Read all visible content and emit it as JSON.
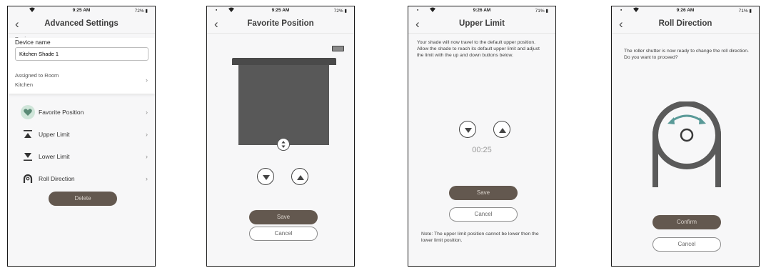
{
  "status": {
    "screen1_time": "9:25 AM",
    "screen1_battery": "72%",
    "screen2_time": "9:25 AM",
    "screen2_battery": "72%",
    "screen3_time": "9:26 AM",
    "screen3_battery": "71%",
    "screen4_time": "9:26 AM",
    "screen4_battery": "71%"
  },
  "icons": {
    "back": "chevron-left-icon",
    "signal": "signal-icon",
    "wifi": "wifi-icon",
    "battery": "battery-icon",
    "chevron": "chevron-right-icon",
    "heart": "heart-icon",
    "up_limit": "upper-limit-icon",
    "low_limit": "lower-limit-icon",
    "roll": "roll-direction-icon",
    "arrow_up": "triangle-up-icon",
    "arrow_down": "triangle-down-icon"
  },
  "colors": {
    "accent_dark": "#63584f",
    "shade": "#585858",
    "heart_bg": "#cfe5d9",
    "heart": "#5a8a75",
    "arrow": "#5a9a98"
  },
  "advanced": {
    "title": "Advanced Settings",
    "overlap_label": "Device name",
    "device_name_label": "Device name",
    "device_name_value": "Kitchen Shade 1",
    "room_label": "Assigned to Room",
    "room_value": "Kitchen",
    "items": [
      {
        "label": "Favorite Position"
      },
      {
        "label": "Upper Limit"
      },
      {
        "label": "Lower Limit"
      },
      {
        "label": "Roll Direction"
      }
    ],
    "delete_label": "Delete"
  },
  "favorite": {
    "title": "Favorite Position",
    "save_label": "Save",
    "cancel_label": "Cancel"
  },
  "upper": {
    "title": "Upper Limit",
    "instructions": "Your shade will now travel to the default upper position. Allow the shade to reach its default upper limit and adjust the limit with the up and down buttons below.",
    "timer": "00:25",
    "save_label": "Save",
    "cancel_label": "Cancel",
    "note": "Note: The upper limit position cannot be lower then the lower limit position."
  },
  "roll": {
    "title": "Roll Direction",
    "message": "The roller shutter is now ready to change the roll direction. Do you want to proceed?",
    "confirm_label": "Confirm",
    "cancel_label": "Cancel"
  }
}
